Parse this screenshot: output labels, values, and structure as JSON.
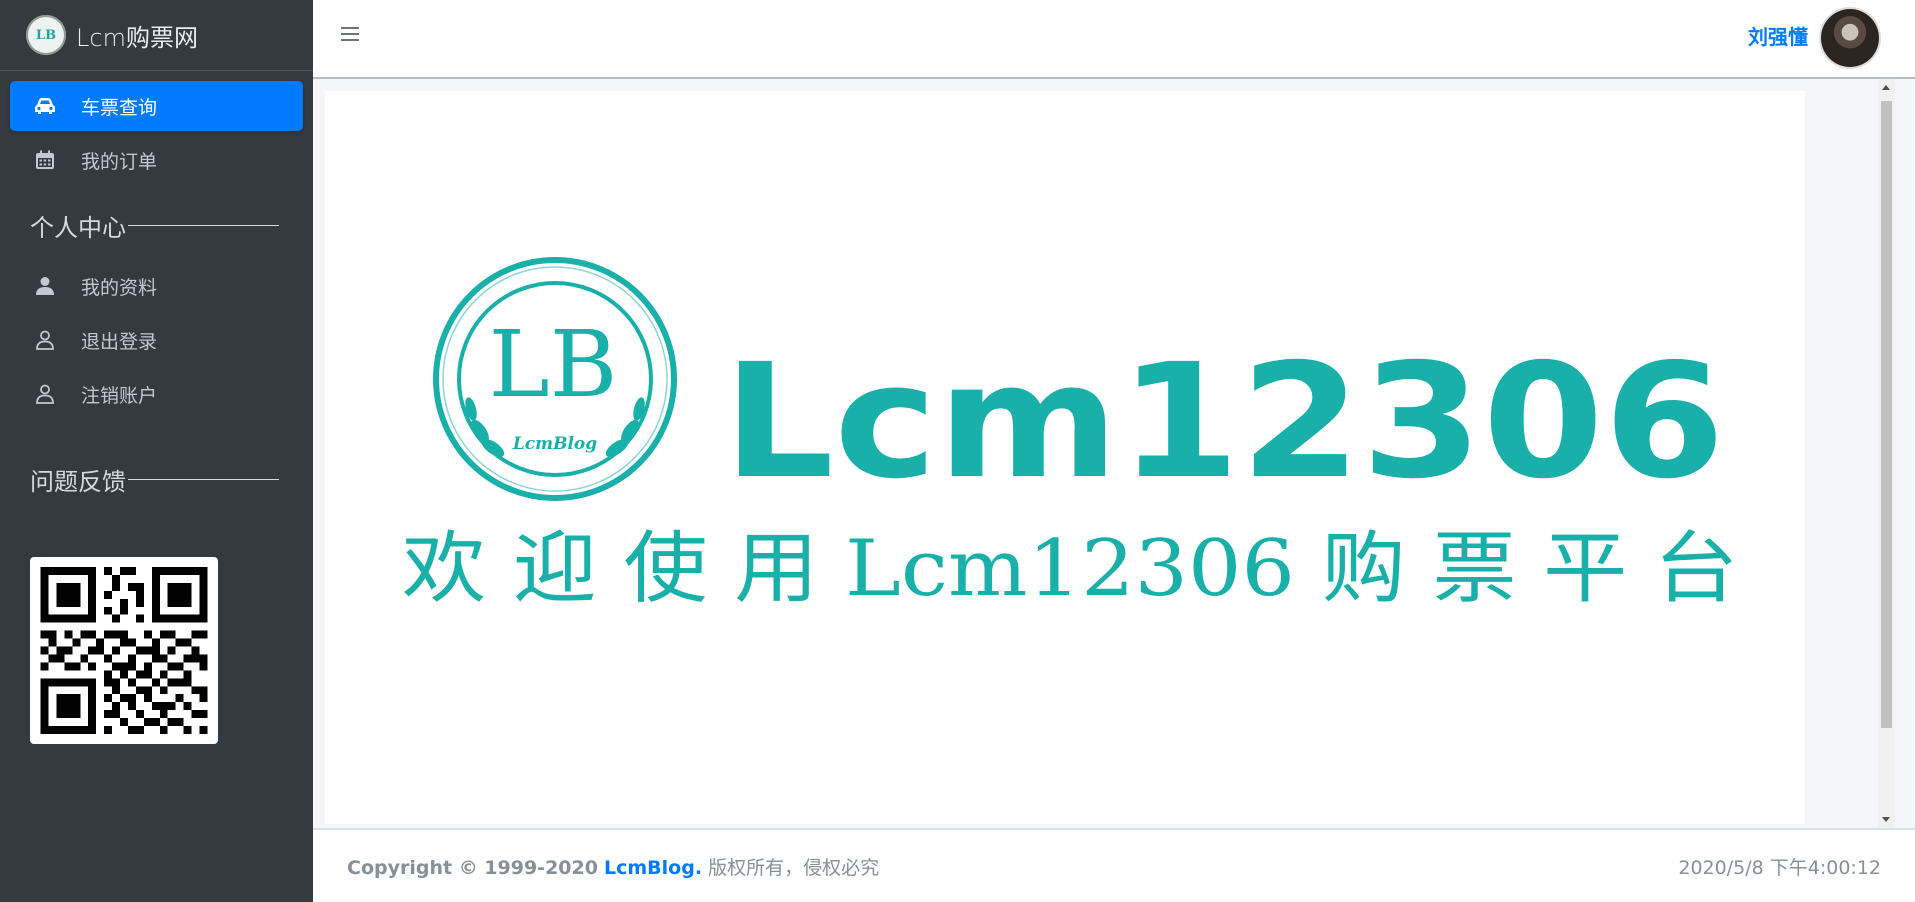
{
  "brand": {
    "logo_text": "LB",
    "title": "Lcm购票网"
  },
  "sidebar": {
    "items": [
      {
        "label": "车票查询",
        "icon": "car-icon",
        "active": true
      },
      {
        "label": "我的订单",
        "icon": "calendar-icon",
        "active": false
      }
    ],
    "section_personal": {
      "title": "个人中心"
    },
    "personal_items": [
      {
        "label": "我的资料",
        "icon": "user-solid-icon"
      },
      {
        "label": "退出登录",
        "icon": "user-outline-icon"
      },
      {
        "label": "注销账户",
        "icon": "user-outline-icon"
      }
    ],
    "section_feedback": {
      "title": "问题反馈"
    }
  },
  "topbar": {
    "user_name": "刘强懂"
  },
  "banner": {
    "logo_letters": "LB",
    "logo_caption": "LcmBlog",
    "title": "Lcm12306",
    "subtitle": "欢 迎 使 用 Lcm12306 购 票 平 台",
    "accent_color": "#1ab0aa"
  },
  "footer": {
    "copyright_prefix": "Copyright © 1999-2020",
    "copyright_link": "LcmBlog.",
    "copyright_suffix": "版权所有，侵权必究",
    "datetime": "2020/5/8 下午4:00:12"
  }
}
